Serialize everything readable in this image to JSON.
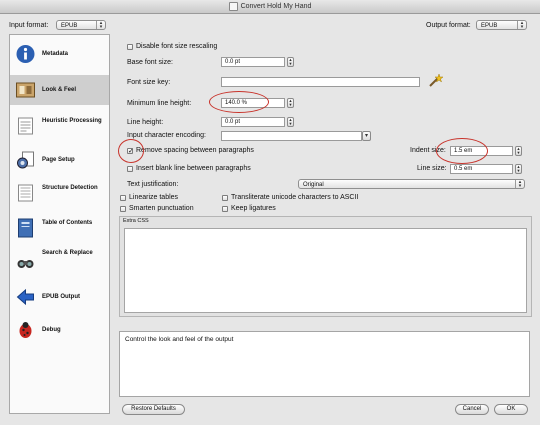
{
  "window": {
    "title": "Convert Hold My Hand"
  },
  "header": {
    "input_format_label": "Input format:",
    "input_format_value": "EPUB",
    "output_format_label": "Output format:",
    "output_format_value": "EPUB"
  },
  "sidebar": {
    "items": [
      {
        "label": "Metadata",
        "icon": "info-icon"
      },
      {
        "label": "Look & Feel",
        "icon": "look-and-feel-icon"
      },
      {
        "label": "Heuristic Processing",
        "icon": "heuristic-icon"
      },
      {
        "label": "Page Setup",
        "icon": "page-setup-icon"
      },
      {
        "label": "Structure Detection",
        "icon": "structure-icon"
      },
      {
        "label": "Table of Contents",
        "icon": "toc-icon"
      },
      {
        "label": "Search & Replace",
        "icon": "search-replace-icon"
      },
      {
        "label": "EPUB Output",
        "icon": "epub-output-icon"
      },
      {
        "label": "Debug",
        "icon": "debug-icon"
      }
    ]
  },
  "form": {
    "disable_font_size_rescaling": "Disable font size rescaling",
    "base_font_size_label": "Base font size:",
    "base_font_size_value": "0.0 pt",
    "font_size_key_label": "Font size key:",
    "font_size_key_value": "",
    "min_line_height_label": "Minimum line height:",
    "min_line_height_value": "140.0 %",
    "line_height_label": "Line height:",
    "line_height_value": "0.0 pt",
    "input_encoding_label": "Input character encoding:",
    "input_encoding_value": "",
    "remove_spacing_label": "Remove spacing between paragraphs",
    "indent_size_label": "Indent size:",
    "indent_size_value": "1.5 em",
    "insert_blank_label": "Insert blank line between paragraphs",
    "line_size_label": "Line size:",
    "line_size_value": "0.5 em",
    "text_justification_label": "Text justification:",
    "text_justification_value": "Original",
    "linearize_tables": "Linearize tables",
    "transliterate": "Transliterate unicode characters to ASCII",
    "smarten_punctuation": "Smarten punctuation",
    "keep_ligatures": "Keep ligatures",
    "extra_css_label": "Extra CSS",
    "extra_css_value": ""
  },
  "help": {
    "text": "Control the look and feel of the output"
  },
  "footer": {
    "restore_defaults": "Restore Defaults",
    "cancel": "Cancel",
    "ok": "OK"
  },
  "state": {
    "remove_spacing_checked": true
  }
}
